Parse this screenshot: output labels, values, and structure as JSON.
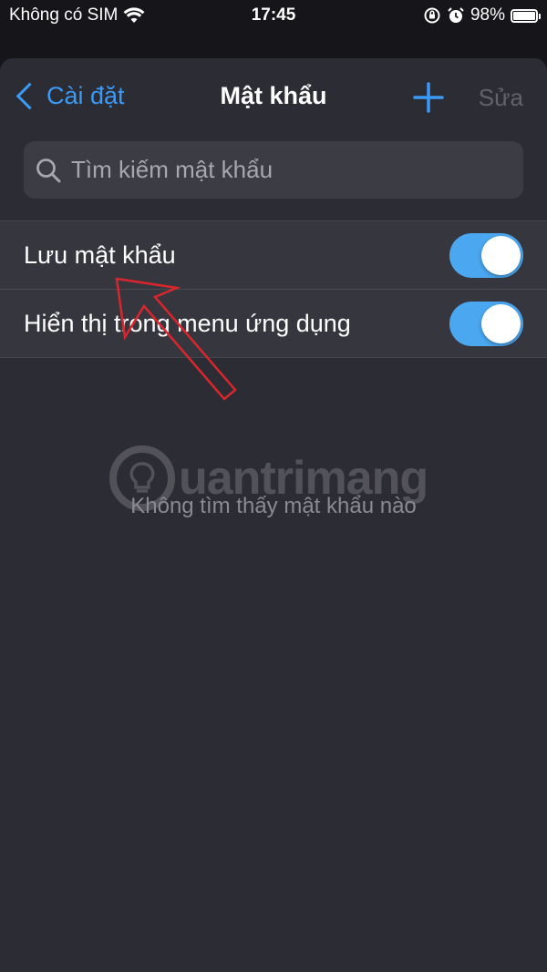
{
  "status": {
    "carrier": "Không có SIM",
    "time": "17:45",
    "battery": "98%",
    "battery_level": 0.98
  },
  "nav": {
    "back_label": "Cài đặt",
    "title": "Mật khẩu",
    "edit_label": "Sửa"
  },
  "search": {
    "placeholder": "Tìm kiếm mật khẩu"
  },
  "settings": [
    {
      "label": "Lưu mật khẩu",
      "on": true
    },
    {
      "label": "Hiển thị trong menu ứng dụng",
      "on": true
    }
  ],
  "empty_message": "Không tìm thấy mật khẩu nào",
  "watermark": "uantrimang",
  "colors": {
    "accent": "#3b9af5",
    "toggle_on": "#4aa7f0",
    "annotation": "#d9262c"
  }
}
